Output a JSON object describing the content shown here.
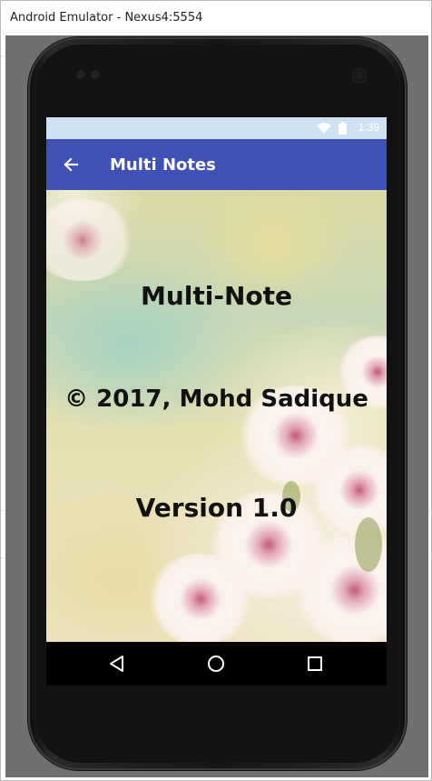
{
  "window": {
    "title": "Android Emulator - Nexus4:5554"
  },
  "statusbar": {
    "time": "1:39"
  },
  "appbar": {
    "title": "Multi Notes"
  },
  "content": {
    "app_name": "Multi-Note",
    "copyright": "© 2017, Mohd Sadique",
    "version": "Version 1.0"
  },
  "icons": {
    "back": "arrow-back-icon",
    "wifi": "wifi-icon",
    "battery": "battery-icon",
    "nav_back": "triangle-back-icon",
    "nav_home": "circle-home-icon",
    "nav_recents": "square-recents-icon"
  },
  "colors": {
    "appbar": "#3f51b5",
    "statusbar": "#cfe2f3",
    "navbar": "#000000"
  }
}
